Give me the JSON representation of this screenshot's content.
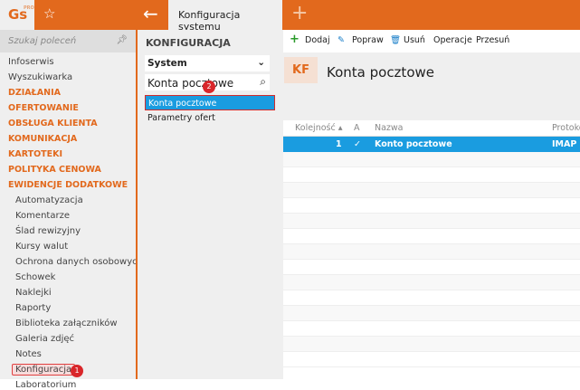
{
  "topbar": {
    "logo": "Gs",
    "logo_sup": "PRO",
    "tab_title": "Konfiguracja systemu"
  },
  "sidebar": {
    "search_placeholder": "Szukaj poleceń",
    "items": [
      {
        "label": "Infoserwis",
        "type": "item"
      },
      {
        "label": "Wyszukiwarka",
        "type": "item"
      },
      {
        "label": "DZIAŁANIA",
        "type": "cat"
      },
      {
        "label": "OFERTOWANIE",
        "type": "cat"
      },
      {
        "label": "OBSŁUGA KLIENTA",
        "type": "cat"
      },
      {
        "label": "KOMUNIKACJA",
        "type": "cat"
      },
      {
        "label": "KARTOTEKI",
        "type": "cat"
      },
      {
        "label": "POLITYKA CENOWA",
        "type": "cat"
      },
      {
        "label": "EWIDENCJE DODATKOWE",
        "type": "cat"
      },
      {
        "label": "Automatyzacja",
        "type": "sub"
      },
      {
        "label": "Komentarze",
        "type": "sub"
      },
      {
        "label": "Ślad rewizyjny",
        "type": "sub"
      },
      {
        "label": "Kursy walut",
        "type": "sub"
      },
      {
        "label": "Ochrona danych osobowych",
        "type": "sub"
      },
      {
        "label": "Schowek",
        "type": "sub"
      },
      {
        "label": "Naklejki",
        "type": "sub"
      },
      {
        "label": "Raporty",
        "type": "sub"
      },
      {
        "label": "Biblioteka załączników",
        "type": "sub"
      },
      {
        "label": "Galeria zdjęć",
        "type": "sub"
      },
      {
        "label": "Notes",
        "type": "sub"
      },
      {
        "label": "Konfiguracja",
        "type": "sub"
      },
      {
        "label": "Laboratorium",
        "type": "sub"
      }
    ],
    "badge": "1"
  },
  "config": {
    "heading": "KONFIGURACJA",
    "select_value": "System",
    "filter_value": "Konta pocztowe",
    "badge": "2",
    "list": [
      "Konta pocztowe",
      "Parametry ofert"
    ]
  },
  "toolbar": {
    "add": "Dodaj",
    "edit": "Popraw",
    "delete": "Usuń",
    "operations": "Operacje",
    "move": "Przesuń"
  },
  "main": {
    "badge": "KF",
    "title": "Konta pocztowe",
    "columns": [
      "Kolejność",
      "A",
      "Nazwa",
      "Protokół"
    ],
    "rows": [
      {
        "order": "1",
        "active": "✓",
        "name": "Konto pocztowe",
        "protocol": "IMAP"
      }
    ]
  }
}
